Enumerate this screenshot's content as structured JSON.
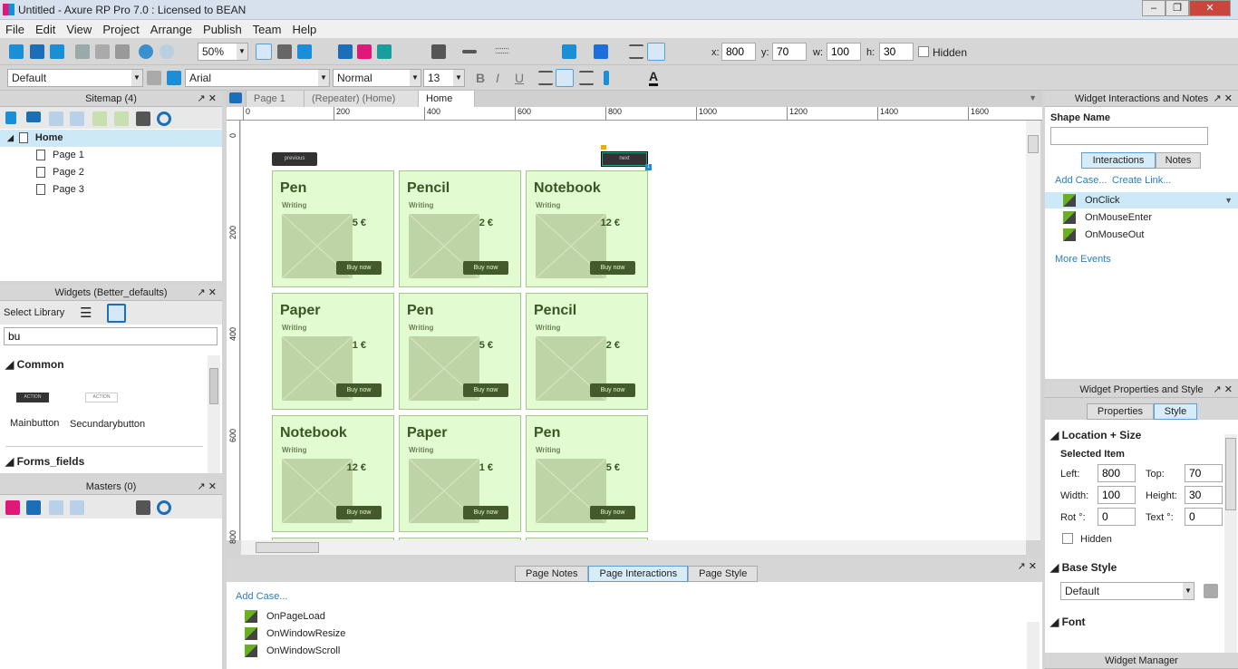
{
  "window": {
    "title": "Untitled - Axure RP Pro 7.0 : Licensed to BEAN"
  },
  "menu": [
    "File",
    "Edit",
    "View",
    "Project",
    "Arrange",
    "Publish",
    "Team",
    "Help"
  ],
  "toolbar": {
    "zoom": "50%",
    "x_label": "x:",
    "x": "800",
    "y_label": "y:",
    "y": "70",
    "w_label": "w:",
    "w": "100",
    "h_label": "h:",
    "h": "30",
    "hidden_label": "Hidden",
    "style": "Default",
    "font": "Arial",
    "weight": "Normal",
    "size": "13"
  },
  "sitemap": {
    "title": "Sitemap (4)",
    "items": [
      {
        "label": "Home",
        "selected": true
      },
      {
        "label": "Page 1"
      },
      {
        "label": "Page 2"
      },
      {
        "label": "Page 3"
      }
    ]
  },
  "widgets": {
    "title": "Widgets (Better_defaults)",
    "select_library": "Select Library",
    "search": "bu",
    "section1": "Common",
    "items": [
      {
        "label": "Mainbutton",
        "thumb": "ACTION"
      },
      {
        "label": "Secundarybutton",
        "thumb": "ACTION"
      }
    ],
    "section2": "Forms_fields"
  },
  "masters": {
    "title": "Masters (0)"
  },
  "tabs": [
    {
      "label": "Page 1"
    },
    {
      "label": "(Repeater) (Home)"
    },
    {
      "label": "Home",
      "active": true
    }
  ],
  "ruler": {
    "h": [
      "0",
      "200",
      "400",
      "600",
      "800",
      "1000",
      "1200",
      "1400",
      "1600"
    ],
    "v": [
      "0",
      "200",
      "400",
      "600",
      "800"
    ]
  },
  "canvas": {
    "previous": "previous",
    "next": "next",
    "buy": "Buy now",
    "cards": [
      {
        "name": "Pen",
        "cat": "Writing",
        "price": "5 €"
      },
      {
        "name": "Pencil",
        "cat": "Writing",
        "price": "2 €"
      },
      {
        "name": "Notebook",
        "cat": "Writing",
        "price": "12 €"
      },
      {
        "name": "Paper",
        "cat": "Writing",
        "price": "1 €"
      },
      {
        "name": "Pen",
        "cat": "Writing",
        "price": "5 €"
      },
      {
        "name": "Pencil",
        "cat": "Writing",
        "price": "2 €"
      },
      {
        "name": "Notebook",
        "cat": "Writing",
        "price": "12 €"
      },
      {
        "name": "Paper",
        "cat": "Writing",
        "price": "1 €"
      },
      {
        "name": "Pen",
        "cat": "Writing",
        "price": "5 €"
      }
    ]
  },
  "bottom": {
    "tabs": [
      "Page Notes",
      "Page Interactions",
      "Page Style"
    ],
    "active": "Page Interactions",
    "add_case": "Add Case...",
    "events": [
      "OnPageLoad",
      "OnWindowResize",
      "OnWindowScroll"
    ]
  },
  "interactions": {
    "title": "Widget Interactions and Notes",
    "shape_name_label": "Shape Name",
    "shape_name": "",
    "tabs": [
      "Interactions",
      "Notes"
    ],
    "add_case": "Add Case...",
    "create_link": "Create Link...",
    "events": [
      "OnClick",
      "OnMouseEnter",
      "OnMouseOut"
    ],
    "more": "More Events"
  },
  "properties": {
    "title": "Widget Properties and Style",
    "tabs": [
      "Properties",
      "Style"
    ],
    "location": "Location + Size",
    "selected": "Selected Item",
    "left_label": "Left:",
    "left": "800",
    "top_label": "Top:",
    "top": "70",
    "width_label": "Width:",
    "width": "100",
    "height_label": "Height:",
    "height": "30",
    "rot_label": "Rot °:",
    "rot": "0",
    "text_label": "Text °:",
    "text": "0",
    "hidden": "Hidden",
    "base_style": "Base Style",
    "base_value": "Default",
    "font": "Font"
  },
  "widget_manager": "Widget Manager",
  "colors": {
    "card_bg": "#e2fbd0",
    "button": "#445a2c",
    "accent": "#2a7fc1"
  }
}
